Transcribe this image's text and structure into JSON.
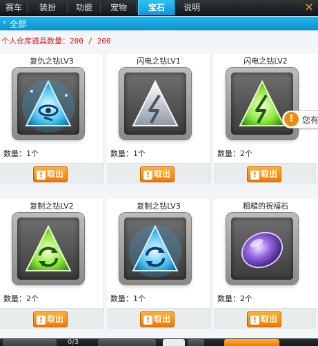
{
  "tabs": [
    {
      "label": "赛车",
      "active": false
    },
    {
      "label": "装扮",
      "active": false
    },
    {
      "label": "功能",
      "active": false
    },
    {
      "label": "宠物",
      "active": false
    },
    {
      "label": "宝石",
      "active": true
    },
    {
      "label": "说明",
      "active": false
    }
  ],
  "category": {
    "label": "全部"
  },
  "storage": {
    "text": "个人仓库道具数量：200 / 200"
  },
  "items": [
    {
      "name": "复仇之钻LV3",
      "quantity": "数量：1个",
      "gem": "blue-triangle-eye",
      "take_label": "取出"
    },
    {
      "name": "闪电之钻LV1",
      "quantity": "数量：1个",
      "gem": "silver-triangle-lightning",
      "take_label": "取出"
    },
    {
      "name": "闪电之钻LV2",
      "quantity": "数量：2个",
      "gem": "green-triangle-lightning",
      "take_label": "取出"
    },
    {
      "name": "复制之钻LV2",
      "quantity": "数量：2个",
      "gem": "green-triangle-copy",
      "take_label": "取出"
    },
    {
      "name": "复制之钻LV3",
      "quantity": "数量：1个",
      "gem": "blue-triangle-copy",
      "take_label": "取出"
    },
    {
      "name": "粗糙的祝福石",
      "quantity": "数量：2个",
      "gem": "purple-oval-stone",
      "take_label": "取出"
    }
  ],
  "notice": {
    "text": "您有",
    "icon": "!"
  },
  "bottom": {
    "pager": "0/3"
  },
  "colors": {
    "accent": "#1aa8e8",
    "orange": "#f07806",
    "warning": "#e0141a"
  }
}
